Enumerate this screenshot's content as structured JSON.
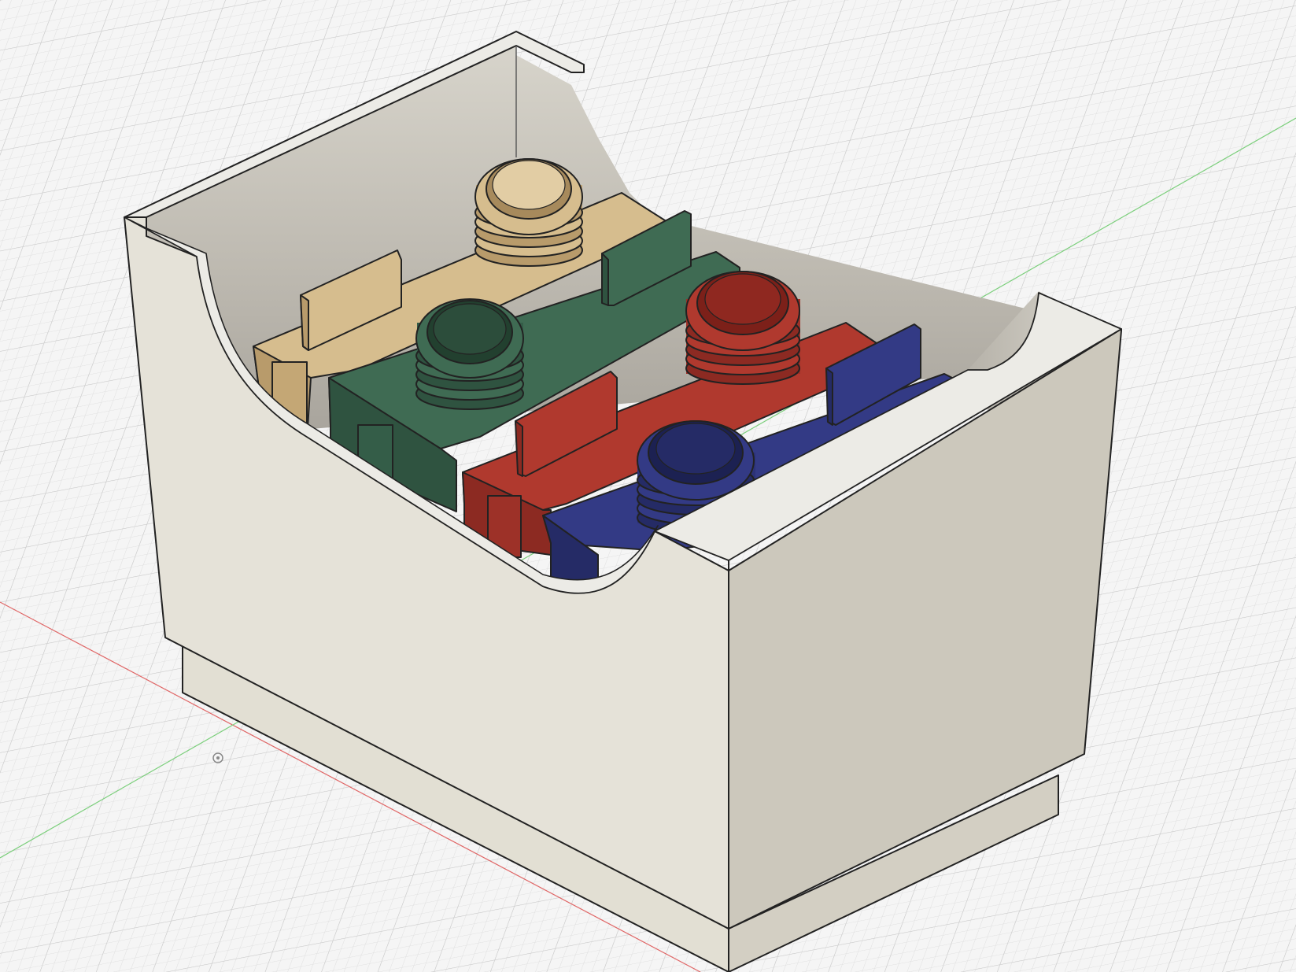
{
  "viewport": {
    "background": "#f5f5f5",
    "grid_minor_color": "#dedede",
    "grid_major_color": "#c9c9c9",
    "x_axis_color": "#e06666",
    "y_axis_color": "#7ccf7c"
  },
  "model": {
    "bin": {
      "light_face": "#e5e2d8",
      "front_face": "#d7d4c8",
      "right_face": "#ccc8bc",
      "inner_wall": "#c9c6bd",
      "base_face": "#e2dfd3",
      "edge": "#222222"
    },
    "cartridges": [
      {
        "name": "tan-cartridge",
        "color": "#d6bd8e",
        "shade": "#b89b6b"
      },
      {
        "name": "green-cartridge",
        "color": "#3f6b53",
        "shade": "#2f5340"
      },
      {
        "name": "red-cartridge",
        "color": "#b0392e",
        "shade": "#8c2a22"
      },
      {
        "name": "blue-cartridge",
        "color": "#333a85",
        "shade": "#252b66"
      }
    ]
  }
}
